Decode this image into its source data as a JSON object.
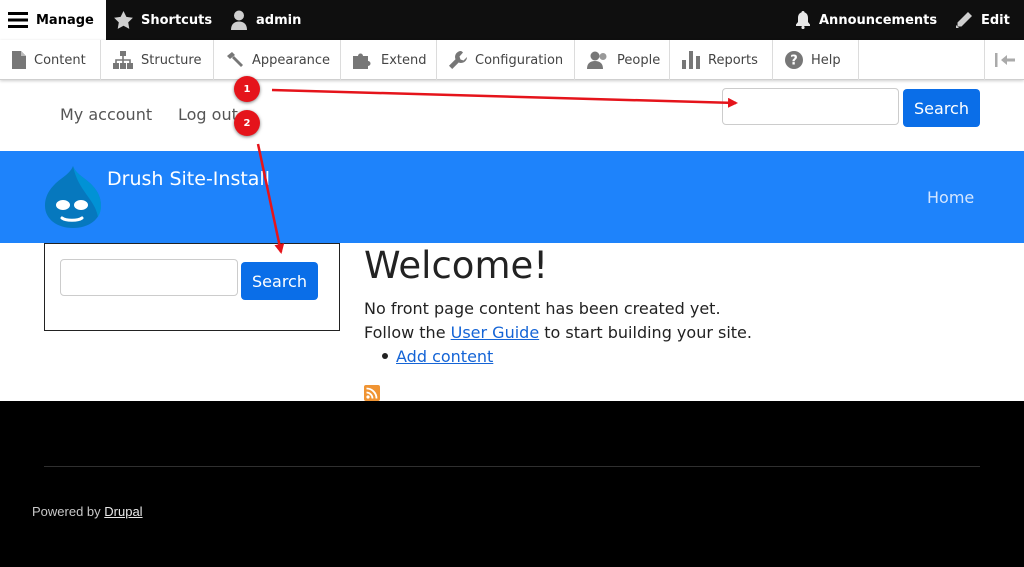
{
  "toolbar": {
    "manage": "Manage",
    "shortcuts": "Shortcuts",
    "user": "admin",
    "announcements": "Announcements",
    "edit": "Edit"
  },
  "tray": {
    "items": [
      "Content",
      "Structure",
      "Appearance",
      "Extend",
      "Configuration",
      "People",
      "Reports",
      "Help"
    ]
  },
  "secondary_menu": {
    "my_account": "My account",
    "log_out": "Log out"
  },
  "header_search": {
    "button": "Search",
    "value": ""
  },
  "site": {
    "name": "Drush Site-Install"
  },
  "main_nav": {
    "home": "Home"
  },
  "sidebar_search": {
    "button": "Search",
    "value": ""
  },
  "main": {
    "title": "Welcome!",
    "line1": "No front page content has been created yet.",
    "line2_prefix": "Follow the ",
    "line2_link": "User Guide",
    "line2_suffix": " to start building your site.",
    "add_content": "Add content"
  },
  "footer": {
    "powered_prefix": "Powered by ",
    "powered_link": "Drupal"
  },
  "annotations": {
    "marker1": "1",
    "marker2": "2"
  },
  "colors": {
    "banner": "#1e83fb",
    "button": "#0a6ee8",
    "annotation": "#e5141b"
  }
}
